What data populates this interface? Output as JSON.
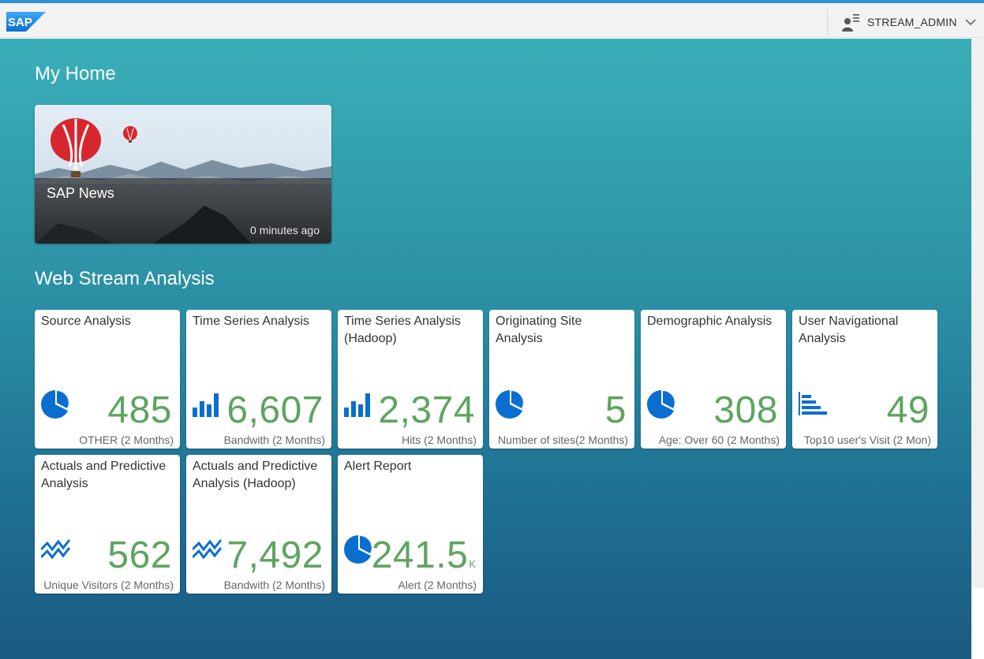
{
  "shell": {
    "logo_text": "SAP",
    "user_name": "STREAM_ADMIN"
  },
  "sections": {
    "my_home_title": "My Home",
    "web_stream_title": "Web Stream Analysis"
  },
  "news_tile": {
    "title": "SAP News",
    "time": "0 minutes ago"
  },
  "colors": {
    "value_green": "#5da55e",
    "icon_blue": "#0a6ed1",
    "header_accent": "#2e8fd0"
  },
  "tiles": [
    {
      "title": "Source Analysis",
      "icon": "pie-chart-icon",
      "value": "485",
      "unit": "",
      "subtitle": "OTHER (2 Months)"
    },
    {
      "title": "Time Series Analysis",
      "icon": "bar-chart-icon",
      "value": "6,607",
      "unit": "",
      "subtitle": "Bandwith (2 Months)"
    },
    {
      "title": "Time Series Analysis (Hadoop)",
      "icon": "bar-chart-icon",
      "value": "2,374",
      "unit": "",
      "subtitle": "Hits (2 Months)"
    },
    {
      "title": "Originating Site Analysis",
      "icon": "pie-chart-icon",
      "value": "5",
      "unit": "",
      "subtitle": "Number of sites(2 Months)"
    },
    {
      "title": "Demographic Analysis",
      "icon": "pie-chart-icon",
      "value": "308",
      "unit": "",
      "subtitle": "Age: Over 60 (2 Months)"
    },
    {
      "title": "User Navigational Analysis",
      "icon": "horizontal-bar-chart-icon",
      "value": "49",
      "unit": "",
      "subtitle": "Top10 user's Visit (2 Mon)"
    },
    {
      "title": "Actuals and Predictive Analysis",
      "icon": "line-chart-icon",
      "value": "562",
      "unit": "",
      "subtitle": "Unique Visitors (2 Months)"
    },
    {
      "title": "Actuals and Predictive Analysis (Hadoop)",
      "icon": "line-chart-icon",
      "value": "7,492",
      "unit": "",
      "subtitle": "Bandwith (2 Months)"
    },
    {
      "title": "Alert Report",
      "icon": "pie-chart-icon",
      "value": "241.5",
      "unit": "K",
      "subtitle": "Alert (2 Months)"
    }
  ]
}
